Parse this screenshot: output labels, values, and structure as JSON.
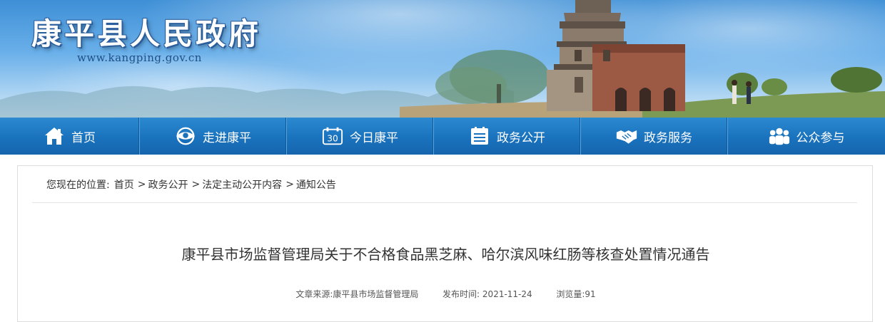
{
  "header": {
    "site_title": "康平县人民政府",
    "site_url": "www.kangping.gov.cn"
  },
  "nav": {
    "items": [
      {
        "label": "首页",
        "icon": "home-icon"
      },
      {
        "label": "走进康平",
        "icon": "map-eye-icon"
      },
      {
        "label": "今日康平",
        "icon": "calendar-30-icon"
      },
      {
        "label": "政务公开",
        "icon": "document-list-icon"
      },
      {
        "label": "政务服务",
        "icon": "handshake-icon"
      },
      {
        "label": "公众参与",
        "icon": "people-icon"
      }
    ]
  },
  "breadcrumb": {
    "prefix": "您现在的位置:",
    "items": [
      "首页",
      "政务公开",
      "法定主动公开内容",
      "通知公告"
    ],
    "separator": ">"
  },
  "article": {
    "title": "康平县市场监督管理局关于不合格食品黑芝麻、哈尔滨风味红肠等核查处置情况通告",
    "source_label": "文章来源:",
    "source": "康平县市场监督管理局",
    "date_label": "发布时间:",
    "date": "2021-11-24",
    "views_label": "浏览量:",
    "views": "91"
  },
  "colors": {
    "nav_bg": "#1a72bd",
    "title_text": "#ffffff",
    "title_outline": "#2a5d9b",
    "url_text": "#1e4f86"
  }
}
